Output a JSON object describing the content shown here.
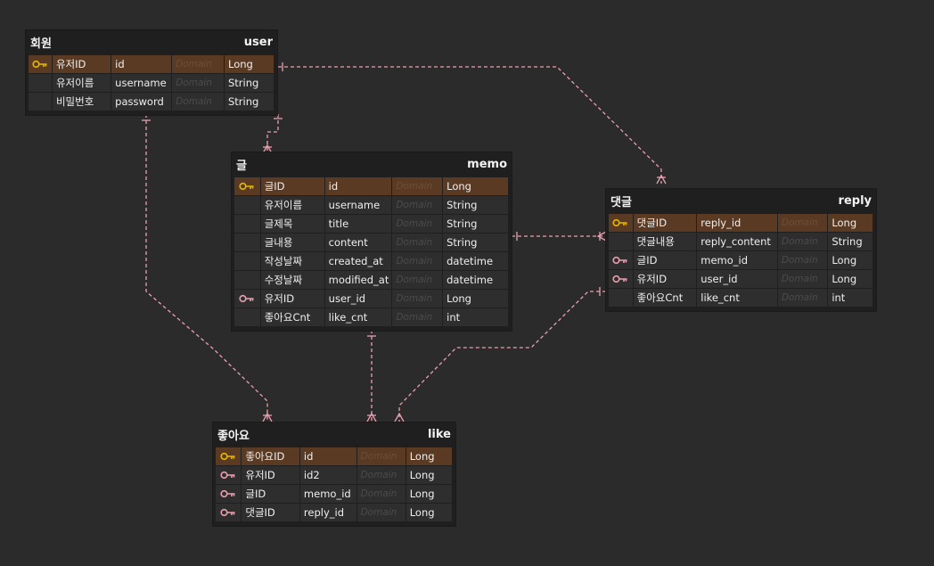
{
  "colors": {
    "background": "#2b2b2b",
    "entity_bg": "#1f1f1f",
    "pk_row": "#5a3a22",
    "relation_line": "#e8a0b0",
    "pk_key": "#e6b800",
    "fk_key": "#e8a0b0"
  },
  "entities": {
    "user": {
      "logical_name": "회원",
      "physical_name": "user",
      "columns": [
        {
          "key": "pk",
          "logical": "유저ID",
          "physical": "id",
          "domain": "Domain",
          "type": "Long"
        },
        {
          "key": "",
          "logical": "유저이름",
          "physical": "username",
          "domain": "Domain",
          "type": "String"
        },
        {
          "key": "",
          "logical": "비밀번호",
          "physical": "password",
          "domain": "Domain",
          "type": "String"
        }
      ]
    },
    "memo": {
      "logical_name": "글",
      "physical_name": "memo",
      "columns": [
        {
          "key": "pk",
          "logical": "글ID",
          "physical": "id",
          "domain": "Domain",
          "type": "Long"
        },
        {
          "key": "",
          "logical": "유저이름",
          "physical": "username",
          "domain": "Domain",
          "type": "String"
        },
        {
          "key": "",
          "logical": "글제목",
          "physical": "title",
          "domain": "Domain",
          "type": "String"
        },
        {
          "key": "",
          "logical": "글내용",
          "physical": "content",
          "domain": "Domain",
          "type": "String"
        },
        {
          "key": "",
          "logical": "작성날짜",
          "physical": "created_at",
          "domain": "Domain",
          "type": "datetime"
        },
        {
          "key": "",
          "logical": "수정날짜",
          "physical": "modified_at",
          "domain": "Domain",
          "type": "datetime"
        },
        {
          "key": "fk",
          "logical": "유저ID",
          "physical": "user_id",
          "domain": "Domain",
          "type": "Long"
        },
        {
          "key": "",
          "logical": "좋아요Cnt",
          "physical": "like_cnt",
          "domain": "Domain",
          "type": "int"
        }
      ]
    },
    "reply": {
      "logical_name": "댓글",
      "physical_name": "reply",
      "columns": [
        {
          "key": "pk",
          "logical": "댓글ID",
          "physical": "reply_id",
          "domain": "Domain",
          "type": "Long"
        },
        {
          "key": "",
          "logical": "댓글내용",
          "physical": "reply_content",
          "domain": "Domain",
          "type": "String"
        },
        {
          "key": "fk",
          "logical": "글ID",
          "physical": "memo_id",
          "domain": "Domain",
          "type": "Long"
        },
        {
          "key": "fk",
          "logical": "유저ID",
          "physical": "user_id",
          "domain": "Domain",
          "type": "Long"
        },
        {
          "key": "",
          "logical": "좋아요Cnt",
          "physical": "like_cnt",
          "domain": "Domain",
          "type": "int"
        }
      ]
    },
    "like": {
      "logical_name": "좋아요",
      "physical_name": "like",
      "columns": [
        {
          "key": "pk",
          "logical": "좋아요ID",
          "physical": "id",
          "domain": "Domain",
          "type": "Long"
        },
        {
          "key": "fk",
          "logical": "유저ID",
          "physical": "id2",
          "domain": "Domain",
          "type": "Long"
        },
        {
          "key": "fk",
          "logical": "글ID",
          "physical": "memo_id",
          "domain": "Domain",
          "type": "Long"
        },
        {
          "key": "fk",
          "logical": "댓글ID",
          "physical": "reply_id",
          "domain": "Domain",
          "type": "Long"
        }
      ]
    }
  }
}
